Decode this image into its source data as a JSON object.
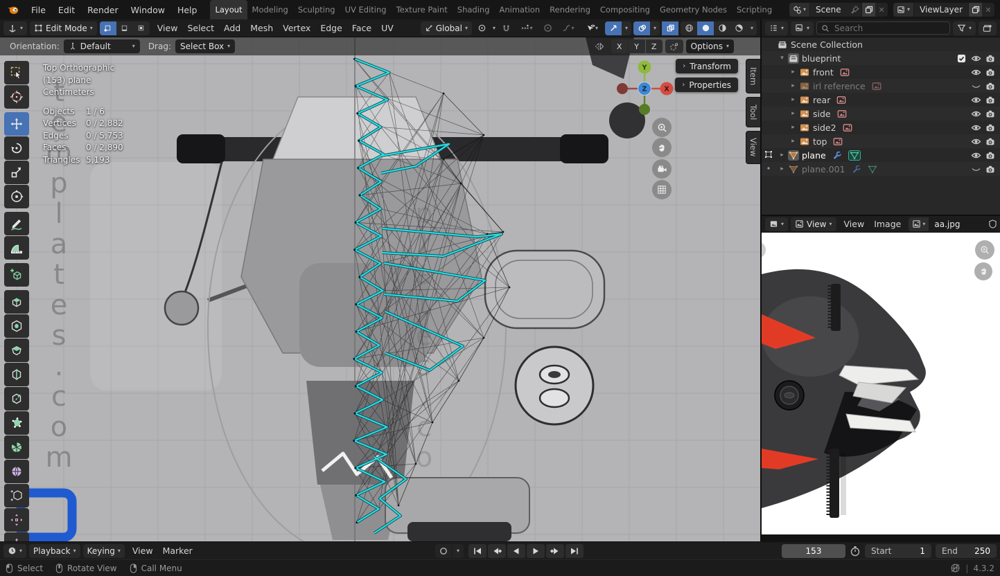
{
  "topbar": {
    "menus": [
      "File",
      "Edit",
      "Render",
      "Window",
      "Help"
    ],
    "workspaces": [
      "Layout",
      "Modeling",
      "Sculpting",
      "UV Editing",
      "Texture Paint",
      "Shading",
      "Animation",
      "Rendering",
      "Compositing",
      "Geometry Nodes",
      "Scripting"
    ],
    "active_workspace": "Layout",
    "scene_label": "Scene",
    "view_layer_label": "ViewLayer"
  },
  "viewport": {
    "mode": "Edit Mode",
    "menus": [
      "View",
      "Select",
      "Add",
      "Mesh",
      "Vertex",
      "Edge",
      "Face",
      "UV"
    ],
    "transform_orientation": "Global",
    "tool_settings": {
      "orientation_label": "Orientation:",
      "orientation_value": "Default",
      "drag_label": "Drag:",
      "drag_value": "Select Box",
      "mirror_axes": [
        "X",
        "Y",
        "Z"
      ],
      "options_label": "Options"
    },
    "overlay": {
      "view_name": "Top Orthographic",
      "object_info": "(153) plane",
      "units": "Centimeters",
      "stats": [
        {
          "label": "Objects",
          "value": "1 / 6"
        },
        {
          "label": "Vertices",
          "value": "0 / 2,882"
        },
        {
          "label": "Edges",
          "value": "0 / 5,753"
        },
        {
          "label": "Faces",
          "value": "0 / 2,890"
        },
        {
          "label": "Triangles",
          "value": "5,193"
        }
      ]
    },
    "gizmo": {
      "x": "X",
      "y": "Y",
      "z": "Z"
    },
    "panel_buttons": [
      "Transform",
      "Properties"
    ],
    "side_tabs": [
      "Item",
      "Tool",
      "View"
    ],
    "watermark_column": "templates.com",
    "watermark_column2": "plates.co",
    "tools": [
      "tweak",
      "cursor",
      "move",
      "rotate",
      "scale",
      "transform",
      "annotate",
      "measure",
      "add-cube",
      "extrude-region",
      "inset-faces",
      "bevel",
      "loop-cut",
      "knife",
      "poly-build",
      "spin",
      "smooth",
      "rip-region",
      "rip-edge",
      "shrink-fatten"
    ],
    "active_tool": "move",
    "tool_group_breaks": [
      2,
      6,
      8,
      9
    ]
  },
  "outliner": {
    "search_placeholder": "Search",
    "rows": [
      {
        "label": "Scene Collection",
        "icon": "collection",
        "indent": 0
      },
      {
        "label": "blueprint",
        "icon": "collection",
        "indent": 1,
        "chevron": "down",
        "icon_box": true,
        "checkbox": true,
        "eye": "open",
        "camera": true
      },
      {
        "label": "front",
        "icon": "image-object",
        "data_icons": [
          "image-data"
        ],
        "indent": 2,
        "chevron": "right",
        "eye": "open",
        "camera": true
      },
      {
        "label": "irl reference",
        "icon": "image-object",
        "data_icons": [
          "image-data"
        ],
        "indent": 2,
        "chevron": "right",
        "dimmed": true,
        "eye": "closed",
        "camera": true
      },
      {
        "label": "rear",
        "icon": "image-object",
        "data_icons": [
          "image-data"
        ],
        "indent": 2,
        "chevron": "right",
        "eye": "open",
        "camera": true
      },
      {
        "label": "side",
        "icon": "image-object",
        "data_icons": [
          "image-data"
        ],
        "indent": 2,
        "chevron": "right",
        "eye": "open",
        "camera": true
      },
      {
        "label": "side2",
        "icon": "image-object",
        "data_icons": [
          "image-data"
        ],
        "indent": 2,
        "chevron": "right",
        "eye": "open",
        "camera": true
      },
      {
        "label": "top",
        "icon": "image-object",
        "data_icons": [
          "image-data"
        ],
        "indent": 2,
        "chevron": "right",
        "eye": "open",
        "camera": true
      },
      {
        "label": "plane",
        "icon": "mesh-object",
        "data_icons": [
          "modifier-wrench",
          "mesh-data-active"
        ],
        "indent": 1,
        "chevron": "right",
        "prefix": "edit-mode",
        "active": true,
        "icon_box": true,
        "eye": "open",
        "camera": true
      },
      {
        "label": "plane.001",
        "icon": "mesh-object",
        "data_icons": [
          "modifier-wrench",
          "mesh-data"
        ],
        "indent": 1,
        "chevron": "right",
        "prefix": "dot",
        "dimmed": true,
        "eye": "closed",
        "camera": true
      }
    ]
  },
  "image_editor": {
    "mode_label": "View",
    "menus": [
      "View",
      "Image"
    ],
    "image_name": "aa.jpg"
  },
  "timeline": {
    "dropdown_menus": [
      "Playback",
      "Keying"
    ],
    "plain_menus": [
      "View",
      "Marker"
    ],
    "transport": [
      "jump-first",
      "prev-keyframe",
      "play-reverse",
      "play",
      "next-keyframe",
      "jump-last"
    ],
    "current_frame": "153",
    "start_label": "Start",
    "start_value": "1",
    "end_label": "End",
    "end_value": "250"
  },
  "status_bar": {
    "hints": [
      {
        "button": "left",
        "label": "Select"
      },
      {
        "button": "middle",
        "label": "Rotate View"
      },
      {
        "button": "right",
        "label": "Call Menu"
      }
    ],
    "version_sep": "|",
    "version": "4.3.2"
  },
  "colors": {
    "accent": "#4772b3",
    "mesh_highlight": "#2bdce4",
    "axis_x": "#d34c43",
    "axis_y": "#8fba3c",
    "axis_z": "#3f87d2"
  }
}
